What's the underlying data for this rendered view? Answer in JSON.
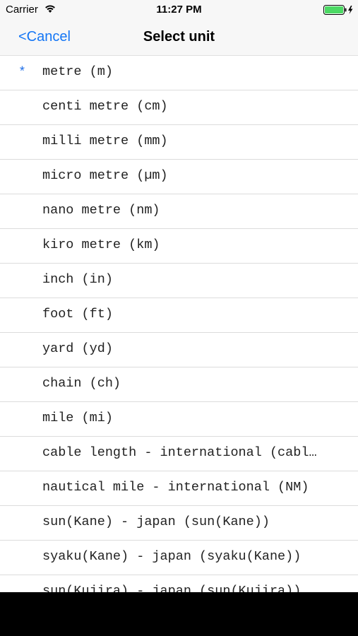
{
  "status_bar": {
    "carrier": "Carrier",
    "time": "11:27 PM",
    "battery_icon": "battery-full-charging-icon",
    "wifi_icon": "wifi-icon"
  },
  "nav": {
    "cancel_label": "<Cancel",
    "title": "Select unit"
  },
  "colors": {
    "accent": "#1476f5",
    "selected_mark": "#1f6fe8",
    "battery_green": "#4cd964"
  },
  "units": [
    {
      "mark": "*",
      "label": "metre (m)",
      "selected": true
    },
    {
      "mark": "",
      "label": "centi metre (cm)"
    },
    {
      "mark": "",
      "label": "milli metre (mm)"
    },
    {
      "mark": "",
      "label": "micro metre (µm)"
    },
    {
      "mark": "",
      "label": "nano metre (nm)"
    },
    {
      "mark": "",
      "label": "kiro metre (km)"
    },
    {
      "mark": "",
      "label": "inch (in)"
    },
    {
      "mark": "",
      "label": "foot (ft)"
    },
    {
      "mark": "",
      "label": "yard (yd)"
    },
    {
      "mark": "",
      "label": "chain (ch)"
    },
    {
      "mark": "",
      "label": "mile (mi)"
    },
    {
      "mark": "",
      "label": "cable length - international (cabl…"
    },
    {
      "mark": "",
      "label": "nautical mile - international (NM)"
    },
    {
      "mark": "",
      "label": "sun(Kane) - japan (sun(Kane))"
    },
    {
      "mark": "",
      "label": "syaku(Kane) - japan (syaku(Kane))"
    },
    {
      "mark": "",
      "label": "sun(Kujira) - japan (sun(Kujira))"
    }
  ]
}
